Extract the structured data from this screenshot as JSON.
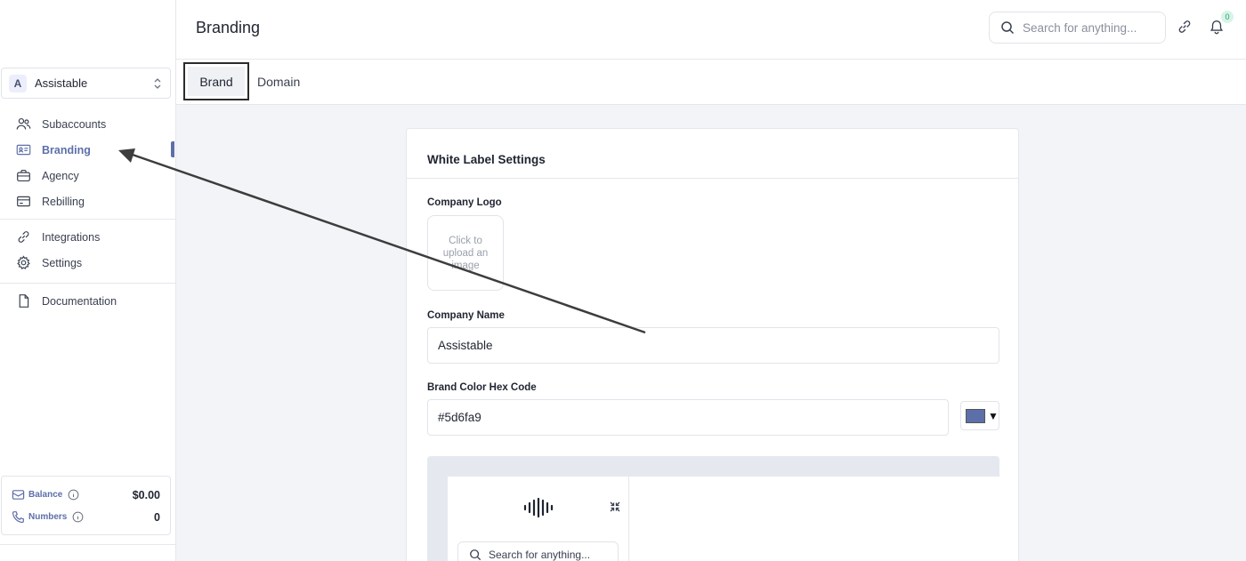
{
  "header": {
    "title": "Branding",
    "search_placeholder": "Search for anything...",
    "notification_count": "0"
  },
  "sidebar": {
    "account": {
      "initial": "A",
      "name": "Assistable"
    },
    "items": [
      {
        "label": "Subaccounts",
        "icon": "users-icon"
      },
      {
        "label": "Branding",
        "icon": "id-card-icon",
        "active": true
      },
      {
        "label": "Agency",
        "icon": "briefcase-icon"
      },
      {
        "label": "Rebilling",
        "icon": "credit-card-icon"
      },
      {
        "label": "Integrations",
        "icon": "link-icon"
      },
      {
        "label": "Settings",
        "icon": "gear-icon"
      },
      {
        "label": "Documentation",
        "icon": "document-icon"
      }
    ],
    "stats": {
      "balance_label": "Balance",
      "balance_value": "$0.00",
      "numbers_label": "Numbers",
      "numbers_value": "0"
    }
  },
  "tabs": [
    {
      "label": "Brand",
      "active": true
    },
    {
      "label": "Domain",
      "active": false
    }
  ],
  "card": {
    "title": "White Label Settings",
    "logo_label": "Company Logo",
    "upload_text": "Click to upload an image",
    "name_label": "Company Name",
    "name_value": "Assistable",
    "color_label": "Brand Color Hex Code",
    "color_value": "#5d6fa9",
    "color_arrow": "▼",
    "preview_search_text": "Search for anything..."
  },
  "colors": {
    "brand": "#5d6fa9",
    "annotation_arrow": "#3d3d3d"
  }
}
